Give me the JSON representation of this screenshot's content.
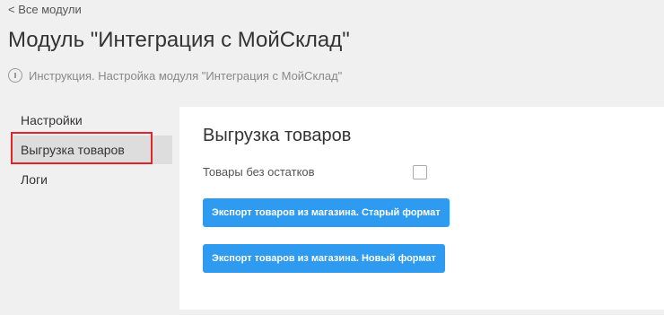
{
  "header": {
    "back_link": "< Все модули",
    "title": "Модуль \"Интеграция с МойСклад\"",
    "instruction": "Инструкция. Настройка модуля \"Интеграция с МойСклад\"",
    "instruction_icon": "info-icon"
  },
  "sidebar": {
    "items": [
      {
        "label": "Настройки",
        "active": false
      },
      {
        "label": "Выгрузка товаров",
        "active": true
      },
      {
        "label": "Логи",
        "active": false
      }
    ]
  },
  "main": {
    "title": "Выгрузка товаров",
    "no_stock_label": "Товары без остатков",
    "no_stock_checked": false,
    "buttons": {
      "export_old": "Экспорт товаров из магазина. Старый формат",
      "export_new": "Экспорт товаров из магазина. Новый формат"
    }
  },
  "colors": {
    "page_background": "#f0f0f0",
    "panel_background": "#ffffff",
    "active_item_background": "#dddddd",
    "highlight_border": "#e0242a",
    "button_background": "#2e9bf0",
    "button_text": "#ffffff"
  }
}
